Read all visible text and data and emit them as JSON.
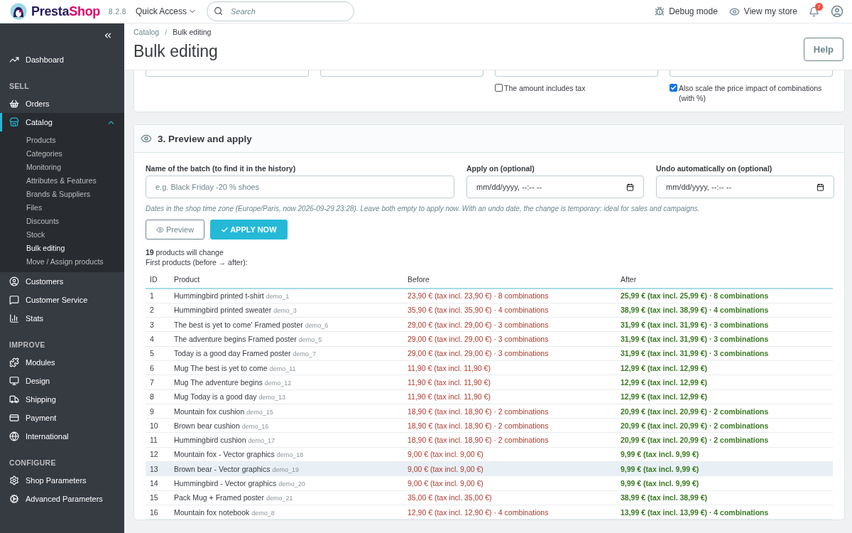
{
  "header": {
    "logo": {
      "part_1": "Presta",
      "part_2": "Shop"
    },
    "version": "8.2.8",
    "quick_access": "Quick Access",
    "search": {
      "placeholder": "Search"
    },
    "debug_mode": "Debug mode",
    "view_store": "View my store",
    "notification_count": "7"
  },
  "sidebar": {
    "sections": [
      {
        "items": [
          {
            "label": "Dashboard",
            "selected": false
          }
        ]
      },
      {
        "title": "SELL",
        "items": [
          {
            "label": "Orders",
            "selected": false
          },
          {
            "label": "Catalog",
            "selected": true,
            "expanded": true,
            "children": [
              {
                "label": "Products",
                "selected": false
              },
              {
                "label": "Categories",
                "selected": false
              },
              {
                "label": "Monitoring",
                "selected": false
              },
              {
                "label": "Attributes & Features",
                "selected": false
              },
              {
                "label": "Brands & Suppliers",
                "selected": false
              },
              {
                "label": "Files",
                "selected": false
              },
              {
                "label": "Discounts",
                "selected": false
              },
              {
                "label": "Stock",
                "selected": false
              },
              {
                "label": "Bulk editing",
                "selected": true
              },
              {
                "label": "Move / Assign products",
                "selected": false
              }
            ]
          },
          {
            "label": "Customers",
            "selected": false
          },
          {
            "label": "Customer Service",
            "selected": false
          },
          {
            "label": "Stats",
            "selected": false
          }
        ]
      },
      {
        "title": "IMPROVE",
        "items": [
          {
            "label": "Modules",
            "selected": false
          },
          {
            "label": "Design",
            "selected": false
          },
          {
            "label": "Shipping",
            "selected": false
          },
          {
            "label": "Payment",
            "selected": false
          },
          {
            "label": "International",
            "selected": false
          }
        ]
      },
      {
        "title": "CONFIGURE",
        "items": [
          {
            "label": "Shop Parameters",
            "selected": false
          },
          {
            "label": "Advanced Parameters",
            "selected": false
          }
        ]
      }
    ]
  },
  "breadcrumb": {
    "items": [
      "Catalog",
      "Bulk editing"
    ],
    "separator": "/"
  },
  "title": "Bulk editing",
  "help_button": "Help",
  "previous_section": {
    "checkboxes": [
      {
        "label": "The amount includes tax",
        "checked": false
      },
      {
        "label": "Also scale the price impact of combinations (with %)",
        "checked": true
      }
    ]
  },
  "preview_section": {
    "title": "3. Preview and apply",
    "fields": [
      {
        "label": "Name of the batch (to find it in the history)",
        "kind": "text",
        "placeholder": "e.g. Black Friday -20 % shoes"
      },
      {
        "label": "Apply on (optional)",
        "kind": "datetime",
        "placeholder": "mm/dd/yyyy, --:-- --"
      },
      {
        "label": "Undo automatically on (optional)",
        "kind": "datetime",
        "placeholder": "mm/dd/yyyy, --:-- --"
      }
    ],
    "hint": "Dates in the shop time zone (Europe/Paris, now 2026-09-29 23:28). Leave both empty to apply now. With an undo date, the change is temporary: ideal for sales and campaigns.",
    "preview_button": "Preview",
    "apply_button": "APPLY NOW",
    "summary": "**19** products will change",
    "list_caption": "First products (before → after):",
    "table": {
      "columns": [
        "ID",
        "Product",
        "Before",
        "After"
      ],
      "rows": [
        {
          "id": "1",
          "product": "Hummingbird printed t-shirt",
          "reference": "demo_1",
          "before": "23,90 € (tax incl. 23,90 €) · 8 combinations",
          "after": "25,99 € (tax incl. 25,99 €) · 8 combinations",
          "highlighted": false
        },
        {
          "id": "2",
          "product": "Hummingbird printed sweater",
          "reference": "demo_3",
          "before": "35,90 € (tax incl. 35,90 €) · 4 combinations",
          "after": "38,99 € (tax incl. 38,99 €) · 4 combinations",
          "highlighted": false
        },
        {
          "id": "3",
          "product": "The best is yet to come' Framed poster",
          "reference": "demo_6",
          "before": "29,00 € (tax incl. 29,00 €) · 3 combinations",
          "after": "31,99 € (tax incl. 31,99 €) · 3 combinations",
          "highlighted": false
        },
        {
          "id": "4",
          "product": "The adventure begins Framed poster",
          "reference": "demo_5",
          "before": "29,00 € (tax incl. 29,00 €) · 3 combinations",
          "after": "31,99 € (tax incl. 31,99 €) · 3 combinations",
          "highlighted": false
        },
        {
          "id": "5",
          "product": "Today is a good day Framed poster",
          "reference": "demo_7",
          "before": "29,00 € (tax incl. 29,00 €) · 3 combinations",
          "after": "31,99 € (tax incl. 31,99 €) · 3 combinations",
          "highlighted": false
        },
        {
          "id": "6",
          "product": "Mug The best is yet to come",
          "reference": "demo_11",
          "before": "11,90 € (tax incl. 11,90 €)",
          "after": "12,99 € (tax incl. 12,99 €)",
          "highlighted": false
        },
        {
          "id": "7",
          "product": "Mug The adventure begins",
          "reference": "demo_12",
          "before": "11,90 € (tax incl. 11,90 €)",
          "after": "12,99 € (tax incl. 12,99 €)",
          "highlighted": false
        },
        {
          "id": "8",
          "product": "Mug Today is a good day",
          "reference": "demo_13",
          "before": "11,90 € (tax incl. 11,90 €)",
          "after": "12,99 € (tax incl. 12,99 €)",
          "highlighted": false
        },
        {
          "id": "9",
          "product": "Mountain fox cushion",
          "reference": "demo_15",
          "before": "18,90 € (tax incl. 18,90 €) · 2 combinations",
          "after": "20,99 € (tax incl. 20,99 €) · 2 combinations",
          "highlighted": false
        },
        {
          "id": "10",
          "product": "Brown bear cushion",
          "reference": "demo_16",
          "before": "18,90 € (tax incl. 18,90 €) · 2 combinations",
          "after": "20,99 € (tax incl. 20,99 €) · 2 combinations",
          "highlighted": false
        },
        {
          "id": "11",
          "product": "Hummingbird cushion",
          "reference": "demo_17",
          "before": "18,90 € (tax incl. 18,90 €) · 2 combinations",
          "after": "20,99 € (tax incl. 20,99 €) · 2 combinations",
          "highlighted": false
        },
        {
          "id": "12",
          "product": "Mountain fox - Vector graphics",
          "reference": "demo_18",
          "before": "9,00 € (tax incl. 9,00 €)",
          "after": "9,99 € (tax incl. 9,99 €)",
          "highlighted": false
        },
        {
          "id": "13",
          "product": "Brown bear - Vector graphics",
          "reference": "demo_19",
          "before": "9,00 € (tax incl. 9,00 €)",
          "after": "9,99 € (tax incl. 9,99 €)",
          "highlighted": true
        },
        {
          "id": "14",
          "product": "Hummingbird - Vector graphics",
          "reference": "demo_20",
          "before": "9,00 € (tax incl. 9,00 €)",
          "after": "9,99 € (tax incl. 9,99 €)",
          "highlighted": false
        },
        {
          "id": "15",
          "product": "Pack Mug + Framed poster",
          "reference": "demo_21",
          "before": "35,00 € (tax incl. 35,00 €)",
          "after": "38,99 € (tax incl. 38,99 €)",
          "highlighted": false
        },
        {
          "id": "16",
          "product": "Mountain fox notebook",
          "reference": "demo_8",
          "before": "12,90 € (tax incl. 12,90 €) · 4 combinations",
          "after": "13,99 € (tax incl. 13,99 €) · 4 combinations",
          "highlighted": false
        }
      ]
    }
  }
}
